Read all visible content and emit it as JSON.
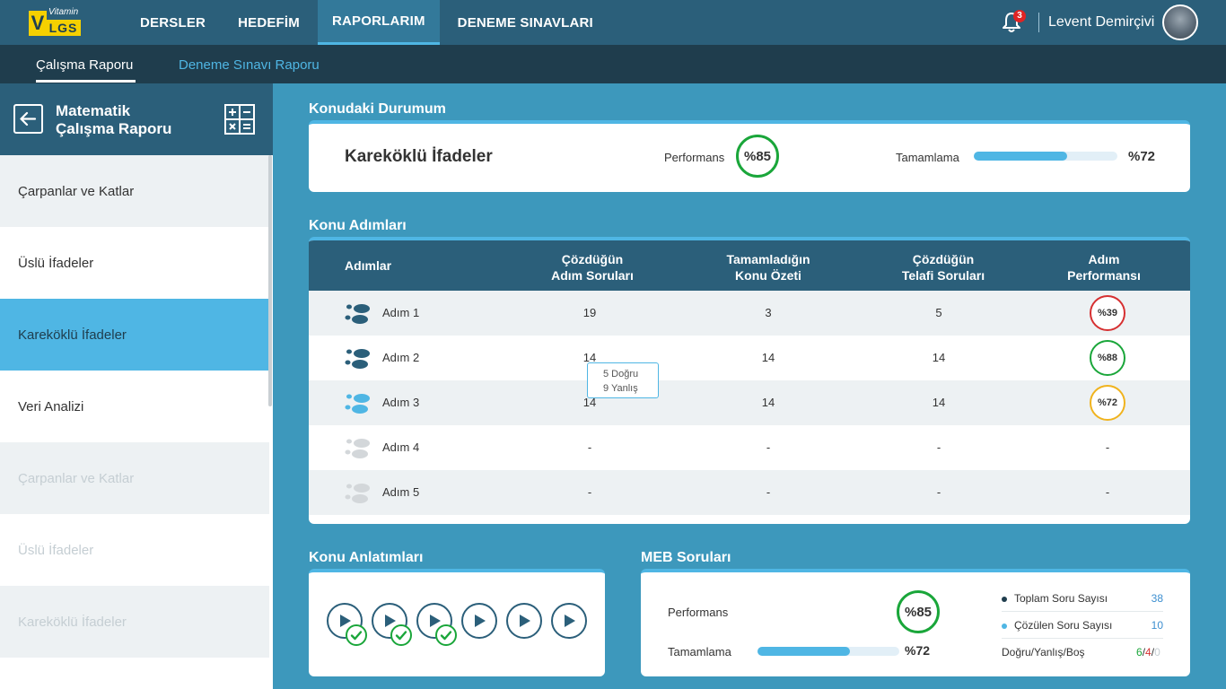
{
  "app": {
    "logo_small": "Vitamin",
    "logo_letter": "V",
    "logo_text": "LGS"
  },
  "nav": {
    "items": [
      "DERSLER",
      "HEDEFİM",
      "RAPORLARIM",
      "DENEME SINAVLARI"
    ],
    "active": "RAPORLARIM"
  },
  "user": {
    "notification_count": "3",
    "name": "Levent Demirçivi"
  },
  "subnav": {
    "tabs": [
      "Çalışma Raporu",
      "Deneme Sınavı Raporu"
    ],
    "active": "Çalışma Raporu"
  },
  "sidebar": {
    "title_line1": "Matematik",
    "title_line2": "Çalışma Raporu",
    "items": [
      {
        "label": "Çarpanlar ve Katlar",
        "state": "normal"
      },
      {
        "label": "Üslü İfadeler",
        "state": "normal"
      },
      {
        "label": "Kareköklü İfadeler",
        "state": "active"
      },
      {
        "label": "Veri Analizi",
        "state": "normal"
      },
      {
        "label": "Çarpanlar ve Katlar",
        "state": "disabled"
      },
      {
        "label": "Üslü İfadeler",
        "state": "disabled"
      },
      {
        "label": "Kareköklü İfadeler",
        "state": "disabled"
      }
    ]
  },
  "status": {
    "section_title": "Konudaki Durumum",
    "topic": "Kareköklü İfadeler",
    "performance_label": "Performans",
    "performance_value": "%85",
    "completion_label": "Tamamlama",
    "completion_value": "%72",
    "completion_fraction": 0.65
  },
  "steps": {
    "section_title": "Konu Adımları",
    "headers": {
      "step": "Adımlar",
      "solved_l1": "Çözdüğün",
      "solved_l2": "Adım Soruları",
      "summary_l1": "Tamamladığın",
      "summary_l2": "Konu Özeti",
      "makeup_l1": "Çözdüğün",
      "makeup_l2": "Telafi Soruları",
      "perf_l1": "Adım",
      "perf_l2": "Performansı"
    },
    "rows": [
      {
        "name": "Adım 1",
        "solved": "19",
        "summary": "3",
        "makeup": "5",
        "perf": "%39",
        "perf_color": "#d63031",
        "icon_color": "#2b5f7a"
      },
      {
        "name": "Adım 2",
        "solved": "14",
        "summary": "14",
        "makeup": "14",
        "perf": "%88",
        "perf_color": "#1aa63a",
        "icon_color": "#2b5f7a"
      },
      {
        "name": "Adım 3",
        "solved": "14",
        "summary": "14",
        "makeup": "14",
        "perf": "%72",
        "perf_color": "#f0b31e",
        "icon_color": "#4fb6e4"
      },
      {
        "name": "Adım 4",
        "solved": "-",
        "summary": "-",
        "makeup": "-",
        "perf": "-",
        "perf_color": "",
        "icon_color": "#d3d7da"
      },
      {
        "name": "Adım 5",
        "solved": "-",
        "summary": "-",
        "makeup": "-",
        "perf": "-",
        "perf_color": "",
        "icon_color": "#d3d7da"
      }
    ],
    "tooltip": {
      "line1": "5 Doğru",
      "line2": "9 Yanlış"
    }
  },
  "videos": {
    "section_title": "Konu Anlatımları",
    "items": [
      {
        "watched": true
      },
      {
        "watched": true
      },
      {
        "watched": true
      },
      {
        "watched": false
      },
      {
        "watched": false
      },
      {
        "watched": false
      }
    ]
  },
  "meb": {
    "section_title": "MEB Soruları",
    "performance_label": "Performans",
    "performance_value": "%85",
    "completion_label": "Tamamlama",
    "completion_value": "%72",
    "completion_fraction": 0.65,
    "legend": [
      {
        "label": "Toplam Soru Sayısı",
        "value": "38",
        "dot": "#1f3d4d"
      },
      {
        "label": "Çözülen Soru Sayısı",
        "value": "10",
        "dot": "#4fb6e4"
      }
    ],
    "dyb_label": "Doğru/Yanlış/Boş",
    "dyb_correct": "6",
    "dyb_wrong": "4",
    "dyb_blank": "0",
    "dyb_slash": "/"
  },
  "colors": {
    "accent": "#4fb6e4",
    "dark": "#2b5f7a",
    "good": "#1aa63a",
    "bad": "#d63031",
    "medium": "#f0b31e"
  }
}
